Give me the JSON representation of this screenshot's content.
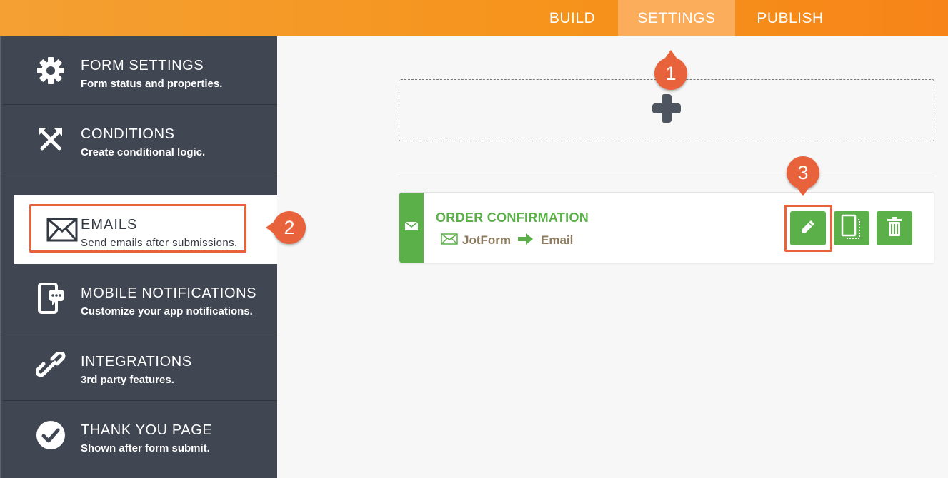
{
  "topnav": {
    "tabs": [
      {
        "label": "BUILD"
      },
      {
        "label": "SETTINGS"
      },
      {
        "label": "PUBLISH"
      }
    ],
    "active": "SETTINGS"
  },
  "sidebar": {
    "items": [
      {
        "title": "FORM SETTINGS",
        "desc": "Form status and properties.",
        "icon": "gear-icon"
      },
      {
        "title": "CONDITIONS",
        "desc": "Create conditional logic.",
        "icon": "conditions-icon"
      },
      {
        "title": "EMAILS",
        "desc": "Send emails after submissions.",
        "icon": "envelope-icon",
        "active": true
      },
      {
        "title": "MOBILE NOTIFICATIONS",
        "desc": "Customize your app notifications.",
        "icon": "mobile-notification-icon"
      },
      {
        "title": "INTEGRATIONS",
        "desc": "3rd party features.",
        "icon": "link-icon"
      },
      {
        "title": "THANK YOU PAGE",
        "desc": "Shown after form submit.",
        "icon": "check-circle-icon"
      }
    ]
  },
  "main": {
    "add_icon": "plus-icon",
    "email_card": {
      "title": "ORDER CONFIRMATION",
      "from": "JotForm",
      "to": "Email",
      "actions": [
        "edit-icon",
        "clone-icon",
        "trash-icon"
      ]
    }
  },
  "callouts": [
    "1",
    "2",
    "3"
  ],
  "colors": {
    "accent_orange": "#f6931b",
    "sidebar_bg": "#404652",
    "green": "#5bb04a",
    "callout": "#e8623b"
  }
}
